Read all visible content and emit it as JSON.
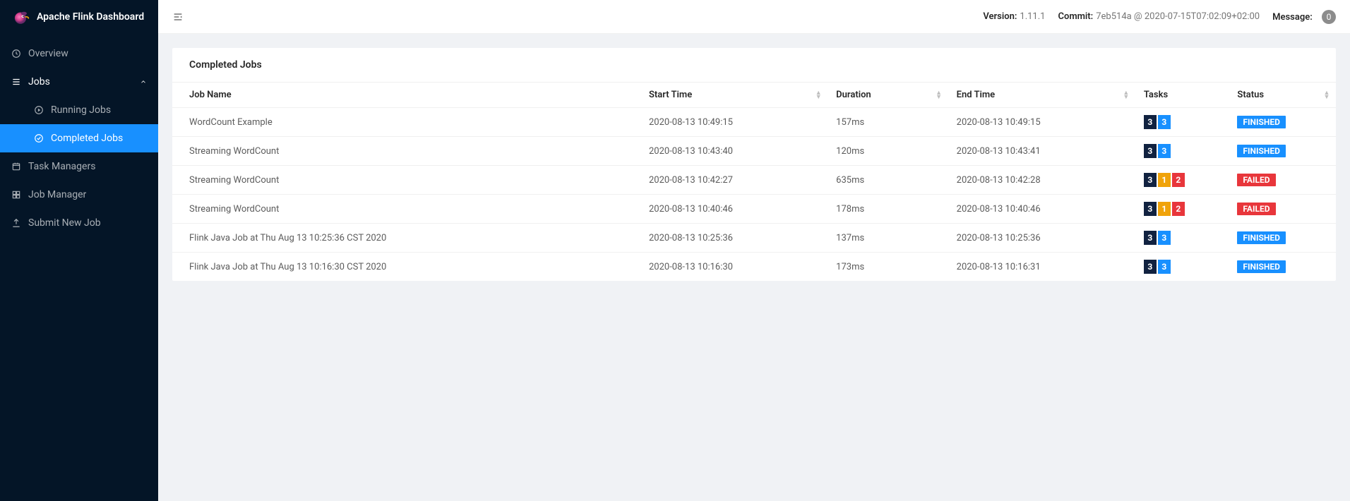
{
  "brand": "Apache Flink Dashboard",
  "topbar": {
    "version_label": "Version:",
    "version_value": "1.11.1",
    "commit_label": "Commit:",
    "commit_value": "7eb514a @ 2020-07-15T07:02:09+02:00",
    "message_label": "Message:",
    "message_count": "0"
  },
  "sidebar": {
    "overview": "Overview",
    "jobs": "Jobs",
    "running": "Running Jobs",
    "completed": "Completed Jobs",
    "task_managers": "Task Managers",
    "job_manager": "Job Manager",
    "submit": "Submit New Job"
  },
  "card": {
    "title": "Completed Jobs"
  },
  "columns": {
    "name": "Job Name",
    "start": "Start Time",
    "duration": "Duration",
    "end": "End Time",
    "tasks": "Tasks",
    "status": "Status"
  },
  "rows": [
    {
      "name": "WordCount Example",
      "start": "2020-08-13 10:49:15",
      "duration": "157ms",
      "end": "2020-08-13 10:49:15",
      "tasks": [
        {
          "n": "3",
          "c": "dark"
        },
        {
          "n": "3",
          "c": "blue"
        }
      ],
      "status": "FINISHED"
    },
    {
      "name": "Streaming WordCount",
      "start": "2020-08-13 10:43:40",
      "duration": "120ms",
      "end": "2020-08-13 10:43:41",
      "tasks": [
        {
          "n": "3",
          "c": "dark"
        },
        {
          "n": "3",
          "c": "blue"
        }
      ],
      "status": "FINISHED"
    },
    {
      "name": "Streaming WordCount",
      "start": "2020-08-13 10:42:27",
      "duration": "635ms",
      "end": "2020-08-13 10:42:28",
      "tasks": [
        {
          "n": "3",
          "c": "dark"
        },
        {
          "n": "1",
          "c": "orange"
        },
        {
          "n": "2",
          "c": "red"
        }
      ],
      "status": "FAILED"
    },
    {
      "name": "Streaming WordCount",
      "start": "2020-08-13 10:40:46",
      "duration": "178ms",
      "end": "2020-08-13 10:40:46",
      "tasks": [
        {
          "n": "3",
          "c": "dark"
        },
        {
          "n": "1",
          "c": "orange"
        },
        {
          "n": "2",
          "c": "red"
        }
      ],
      "status": "FAILED"
    },
    {
      "name": "Flink Java Job at Thu Aug 13 10:25:36 CST 2020",
      "start": "2020-08-13 10:25:36",
      "duration": "137ms",
      "end": "2020-08-13 10:25:36",
      "tasks": [
        {
          "n": "3",
          "c": "dark"
        },
        {
          "n": "3",
          "c": "blue"
        }
      ],
      "status": "FINISHED"
    },
    {
      "name": "Flink Java Job at Thu Aug 13 10:16:30 CST 2020",
      "start": "2020-08-13 10:16:30",
      "duration": "173ms",
      "end": "2020-08-13 10:16:31",
      "tasks": [
        {
          "n": "3",
          "c": "dark"
        },
        {
          "n": "3",
          "c": "blue"
        }
      ],
      "status": "FINISHED"
    }
  ]
}
